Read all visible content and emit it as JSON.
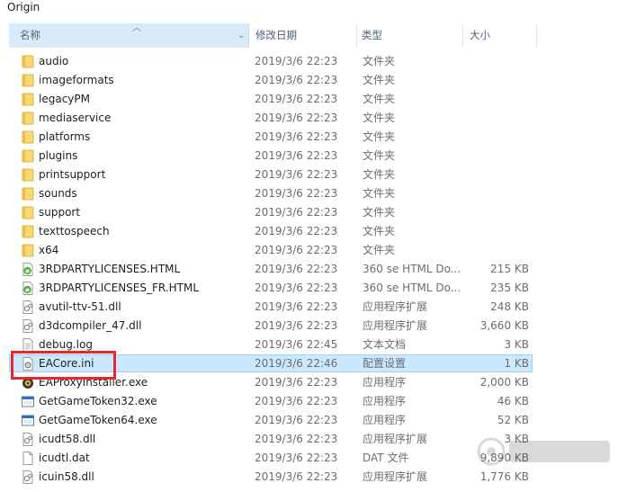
{
  "window": {
    "breadcrumb": "Origin"
  },
  "columns": {
    "name": "名称",
    "date": "修改日期",
    "type": "类型",
    "size": "大小"
  },
  "files": [
    {
      "name": "audio",
      "date": "2019/3/6 22:23",
      "type": "文件夹",
      "size": "",
      "icon": "folder-icon"
    },
    {
      "name": "imageformats",
      "date": "2019/3/6 22:23",
      "type": "文件夹",
      "size": "",
      "icon": "folder-icon"
    },
    {
      "name": "legacyPM",
      "date": "2019/3/6 22:23",
      "type": "文件夹",
      "size": "",
      "icon": "folder-icon"
    },
    {
      "name": "mediaservice",
      "date": "2019/3/6 22:23",
      "type": "文件夹",
      "size": "",
      "icon": "folder-icon"
    },
    {
      "name": "platforms",
      "date": "2019/3/6 22:23",
      "type": "文件夹",
      "size": "",
      "icon": "folder-icon"
    },
    {
      "name": "plugins",
      "date": "2019/3/6 22:23",
      "type": "文件夹",
      "size": "",
      "icon": "folder-icon"
    },
    {
      "name": "printsupport",
      "date": "2019/3/6 22:23",
      "type": "文件夹",
      "size": "",
      "icon": "folder-icon"
    },
    {
      "name": "sounds",
      "date": "2019/3/6 22:23",
      "type": "文件夹",
      "size": "",
      "icon": "folder-icon"
    },
    {
      "name": "support",
      "date": "2019/3/6 22:23",
      "type": "文件夹",
      "size": "",
      "icon": "folder-icon"
    },
    {
      "name": "texttospeech",
      "date": "2019/3/6 22:23",
      "type": "文件夹",
      "size": "",
      "icon": "folder-icon"
    },
    {
      "name": "x64",
      "date": "2019/3/6 22:23",
      "type": "文件夹",
      "size": "",
      "icon": "folder-icon"
    },
    {
      "name": "3RDPARTYLICENSES.HTML",
      "date": "2019/3/6 22:23",
      "type": "360 se HTML Do...",
      "size": "215 KB",
      "icon": "html-file-icon"
    },
    {
      "name": "3RDPARTYLICENSES_FR.HTML",
      "date": "2019/3/6 22:23",
      "type": "360 se HTML Do...",
      "size": "235 KB",
      "icon": "html-file-icon"
    },
    {
      "name": "avutil-ttv-51.dll",
      "date": "2019/3/6 22:23",
      "type": "应用程序扩展",
      "size": "248 KB",
      "icon": "dll-file-icon"
    },
    {
      "name": "d3dcompiler_47.dll",
      "date": "2019/3/6 22:23",
      "type": "应用程序扩展",
      "size": "3,660 KB",
      "icon": "dll-file-icon"
    },
    {
      "name": "debug.log",
      "date": "2019/3/6 22:45",
      "type": "文本文档",
      "size": "3 KB",
      "icon": "text-file-icon"
    },
    {
      "name": "EACore.ini",
      "date": "2019/3/6 22:46",
      "type": "配置设置",
      "size": "1 KB",
      "icon": "ini-file-icon"
    },
    {
      "name": "EAProxyInstaller.exe",
      "date": "2019/3/6 22:23",
      "type": "应用程序",
      "size": "2,000 KB",
      "icon": "installer-exe-icon"
    },
    {
      "name": "GetGameToken32.exe",
      "date": "2019/3/6 22:23",
      "type": "应用程序",
      "size": "46 KB",
      "icon": "exe-file-icon"
    },
    {
      "name": "GetGameToken64.exe",
      "date": "2019/3/6 22:23",
      "type": "应用程序",
      "size": "52 KB",
      "icon": "exe-file-icon"
    },
    {
      "name": "icudt58.dll",
      "date": "2019/3/6 22:23",
      "type": "应用程序扩展",
      "size": "3 KB",
      "icon": "dll-file-icon"
    },
    {
      "name": "icudtl.dat",
      "date": "2019/3/6 22:23",
      "type": "DAT 文件",
      "size": "9,890 KB",
      "icon": "blank-file-icon"
    },
    {
      "name": "icuin58.dll",
      "date": "2019/3/6 22:23",
      "type": "应用程序扩展",
      "size": "1,776 KB",
      "icon": "dll-file-icon"
    }
  ],
  "selected_index": 16,
  "colors": {
    "selection_bg": "#cce8ff",
    "selection_border": "#99d1ff",
    "annotation_red": "#e8262b",
    "header_active": "#d9ebf9",
    "folder_yellow": "#f8d775"
  }
}
